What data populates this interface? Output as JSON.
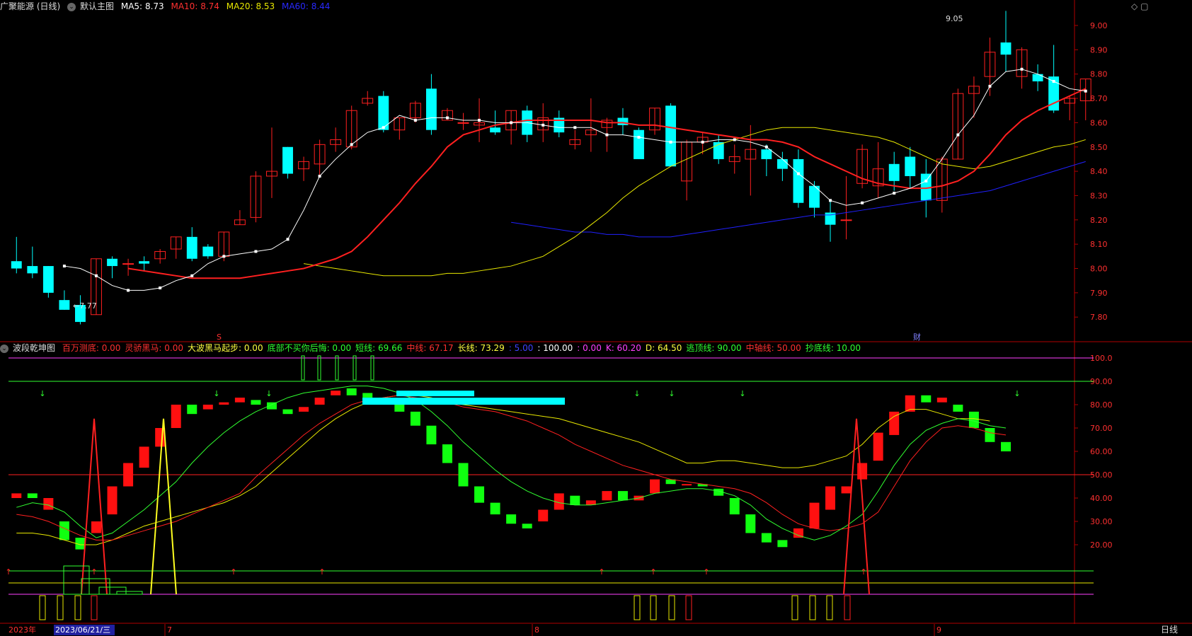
{
  "main_header": {
    "stock": "广聚能源 (日线)",
    "panel": "默认主图",
    "ma5_label": "MA5:",
    "ma5": "8.73",
    "ma10_label": "MA10:",
    "ma10": "8.74",
    "ma20_label": "MA20:",
    "ma20": "8.53",
    "ma60_label": "MA60:",
    "ma60": "8.44"
  },
  "sub_header": {
    "panel": "波段乾坤图",
    "items": [
      {
        "label": "百万测底:",
        "value": "0.00",
        "color": "#ff3030"
      },
      {
        "label": "灵骄黑马:",
        "value": "0.00",
        "color": "#ff3030"
      },
      {
        "label": "大波黑马起步:",
        "value": "0.00",
        "color": "#ffff40"
      },
      {
        "label": "底部不买你后悔:",
        "value": "0.00",
        "color": "#30ff30"
      },
      {
        "label": "短线:",
        "value": "69.66",
        "color": "#30ff30"
      },
      {
        "label": "中线:",
        "value": "67.17",
        "color": "#ff3030"
      },
      {
        "label": "长线:",
        "value": "73.29",
        "color": "#ffff40"
      },
      {
        "label": ":",
        "value": "5.00",
        "color": "#4040ff"
      },
      {
        "label": ":",
        "value": "100.00",
        "color": "#ffffff"
      },
      {
        "label": ":",
        "value": "0.00",
        "color": "#ff40ff"
      },
      {
        "label": "K:",
        "value": "60.20",
        "color": "#ff40ff"
      },
      {
        "label": "D:",
        "value": "64.50",
        "color": "#ffff40"
      },
      {
        "label": "逃顶线:",
        "value": "90.00",
        "color": "#30ff30"
      },
      {
        "label": "中轴线:",
        "value": "50.00",
        "color": "#ff3030"
      },
      {
        "label": "抄底线:",
        "value": "10.00",
        "color": "#30ff30"
      }
    ]
  },
  "price_axis": [
    "9.00",
    "8.90",
    "8.80",
    "8.70",
    "8.60",
    "8.50",
    "8.40",
    "8.30",
    "8.20",
    "8.10",
    "8.00",
    "7.90",
    "7.80"
  ],
  "osc_axis": [
    "100.0",
    "90.00",
    "80.00",
    "70.00",
    "60.00",
    "50.00",
    "40.00",
    "30.00",
    "20.00"
  ],
  "annotations": {
    "high": "9.05",
    "low": "7.77",
    "marker_s": "S",
    "marker_cai": "财"
  },
  "time_axis": {
    "year": "2023年",
    "cursor": "2023/06/21/三",
    "m7": "7",
    "m8": "8",
    "m9": "9"
  },
  "period": "日线",
  "colors": {
    "up": "#ff2020",
    "down": "#00ffff",
    "ma5": "#ffffff",
    "ma10": "#ff2020",
    "ma20": "#e8e800",
    "ma60": "#2020ff"
  },
  "chart_data": {
    "type": "candlestick",
    "candles": [
      [
        8.03,
        8.0,
        8.13,
        7.98
      ],
      [
        8.01,
        7.98,
        8.09,
        7.96
      ],
      [
        8.01,
        7.9,
        8.01,
        7.88
      ],
      [
        7.87,
        7.83,
        7.91,
        7.83
      ],
      [
        7.85,
        7.78,
        7.89,
        7.77
      ],
      [
        7.81,
        8.04,
        8.04,
        7.81
      ],
      [
        8.04,
        8.01,
        8.05,
        7.96
      ],
      [
        8.02,
        8.02,
        8.04,
        7.97
      ],
      [
        8.03,
        8.02,
        8.05,
        7.99
      ],
      [
        8.04,
        8.07,
        8.08,
        8.02
      ],
      [
        8.08,
        8.13,
        8.13,
        8.04
      ],
      [
        8.13,
        8.04,
        8.17,
        8.03
      ],
      [
        8.09,
        8.05,
        8.1,
        8.04
      ],
      [
        8.05,
        8.15,
        8.15,
        8.03
      ],
      [
        8.18,
        8.2,
        8.24,
        8.18
      ],
      [
        8.21,
        8.38,
        8.4,
        8.19
      ],
      [
        8.38,
        8.4,
        8.58,
        8.29
      ],
      [
        8.5,
        8.39,
        8.5,
        8.37
      ],
      [
        8.41,
        8.44,
        8.46,
        8.36
      ],
      [
        8.43,
        8.51,
        8.53,
        8.38
      ],
      [
        8.51,
        8.53,
        8.58,
        8.48
      ],
      [
        8.5,
        8.65,
        8.67,
        8.49
      ],
      [
        8.68,
        8.7,
        8.73,
        8.67
      ],
      [
        8.71,
        8.57,
        8.73,
        8.56
      ],
      [
        8.57,
        8.62,
        8.62,
        8.53
      ],
      [
        8.62,
        8.68,
        8.69,
        8.6
      ],
      [
        8.74,
        8.57,
        8.8,
        8.55
      ],
      [
        8.61,
        8.65,
        8.66,
        8.61
      ],
      [
        8.6,
        8.6,
        8.64,
        8.57
      ],
      [
        8.59,
        8.6,
        8.7,
        8.52
      ],
      [
        8.58,
        8.56,
        8.65,
        8.55
      ],
      [
        8.57,
        8.65,
        8.65,
        8.51
      ],
      [
        8.65,
        8.55,
        8.67,
        8.52
      ],
      [
        8.57,
        8.62,
        8.68,
        8.52
      ],
      [
        8.62,
        8.56,
        8.65,
        8.54
      ],
      [
        8.51,
        8.53,
        8.57,
        8.49
      ],
      [
        8.55,
        8.57,
        8.7,
        8.48
      ],
      [
        8.58,
        8.61,
        8.62,
        8.48
      ],
      [
        8.62,
        8.59,
        8.66,
        8.55
      ],
      [
        8.57,
        8.45,
        8.58,
        8.45
      ],
      [
        8.57,
        8.66,
        8.66,
        8.55
      ],
      [
        8.67,
        8.42,
        8.68,
        8.42
      ],
      [
        8.36,
        8.52,
        8.53,
        8.28
      ],
      [
        8.52,
        8.54,
        8.56,
        8.47
      ],
      [
        8.52,
        8.45,
        8.55,
        8.43
      ],
      [
        8.44,
        8.46,
        8.51,
        8.39
      ],
      [
        8.45,
        8.49,
        8.59,
        8.3
      ],
      [
        8.49,
        8.45,
        8.51,
        8.38
      ],
      [
        8.45,
        8.41,
        8.48,
        8.36
      ],
      [
        8.45,
        8.27,
        8.49,
        8.25
      ],
      [
        8.34,
        8.25,
        8.36,
        8.21
      ],
      [
        8.23,
        8.18,
        8.28,
        8.11
      ],
      [
        8.2,
        8.2,
        8.38,
        8.12
      ],
      [
        8.35,
        8.49,
        8.51,
        8.33
      ],
      [
        8.34,
        8.41,
        8.52,
        8.29
      ],
      [
        8.43,
        8.36,
        8.48,
        8.32
      ],
      [
        8.46,
        8.38,
        8.5,
        8.33
      ],
      [
        8.39,
        8.28,
        8.45,
        8.21
      ],
      [
        8.28,
        8.45,
        8.46,
        8.23
      ],
      [
        8.45,
        8.72,
        8.74,
        8.45
      ],
      [
        8.72,
        8.75,
        8.79,
        8.62
      ],
      [
        8.79,
        8.89,
        8.95,
        8.71
      ],
      [
        8.93,
        8.88,
        9.06,
        8.81
      ],
      [
        8.79,
        8.9,
        8.91,
        8.74
      ],
      [
        8.8,
        8.77,
        8.84,
        8.73
      ],
      [
        8.79,
        8.65,
        8.92,
        8.64
      ],
      [
        8.68,
        8.7,
        8.71,
        8.61
      ],
      [
        8.69,
        8.78,
        8.78,
        8.61
      ]
    ],
    "ma5": [
      8.01,
      8.0,
      7.97,
      7.93,
      7.91,
      7.91,
      7.92,
      7.95,
      7.97,
      8.02,
      8.05,
      8.06,
      8.07,
      8.08,
      8.12,
      8.24,
      8.38,
      8.45,
      8.51,
      8.56,
      8.58,
      8.63,
      8.61,
      8.62,
      8.62,
      8.61,
      8.61,
      8.6,
      8.6,
      8.6,
      8.59,
      8.58,
      8.58,
      8.58,
      8.55,
      8.55,
      8.54,
      8.53,
      8.52,
      8.52,
      8.52,
      8.53,
      8.53,
      8.52,
      8.5,
      8.45,
      8.39,
      8.34,
      8.28,
      8.26,
      8.27,
      8.29,
      8.31,
      8.33,
      8.36,
      8.45,
      8.55,
      8.63,
      8.75,
      8.81,
      8.82,
      8.8,
      8.77,
      8.74,
      8.73
    ],
    "ma10": [
      8.0,
      7.99,
      7.98,
      7.97,
      7.96,
      7.96,
      7.96,
      7.96,
      7.97,
      7.98,
      7.99,
      8.0,
      8.02,
      8.04,
      8.07,
      8.13,
      8.2,
      8.27,
      8.35,
      8.42,
      8.5,
      8.55,
      8.57,
      8.59,
      8.6,
      8.61,
      8.61,
      8.61,
      8.61,
      8.61,
      8.6,
      8.6,
      8.59,
      8.59,
      8.58,
      8.57,
      8.56,
      8.55,
      8.54,
      8.53,
      8.53,
      8.52,
      8.5,
      8.46,
      8.43,
      8.4,
      8.37,
      8.35,
      8.34,
      8.33,
      8.33,
      8.34,
      8.36,
      8.4,
      8.47,
      8.55,
      8.61,
      8.65,
      8.68,
      8.71,
      8.74
    ],
    "ma20": [
      8.02,
      8.01,
      8.0,
      7.99,
      7.98,
      7.97,
      7.97,
      7.97,
      7.97,
      7.98,
      7.98,
      7.99,
      8.0,
      8.01,
      8.03,
      8.05,
      8.09,
      8.13,
      8.18,
      8.23,
      8.29,
      8.34,
      8.38,
      8.42,
      8.45,
      8.48,
      8.51,
      8.53,
      8.55,
      8.57,
      8.58,
      8.58,
      8.58,
      8.57,
      8.56,
      8.55,
      8.54,
      8.52,
      8.49,
      8.46,
      8.43,
      8.42,
      8.41,
      8.42,
      8.44,
      8.46,
      8.48,
      8.5,
      8.51,
      8.53
    ],
    "ma60": [
      8.19,
      8.18,
      8.17,
      8.16,
      8.15,
      8.15,
      8.14,
      8.14,
      8.13,
      8.13,
      8.13,
      8.14,
      8.15,
      8.16,
      8.17,
      8.18,
      8.19,
      8.2,
      8.21,
      8.22,
      8.22,
      8.23,
      8.24,
      8.25,
      8.26,
      8.27,
      8.28,
      8.29,
      8.3,
      8.31,
      8.32,
      8.34,
      8.36,
      8.38,
      8.4,
      8.42,
      8.44
    ],
    "osc_bars": [
      [
        40,
        42
      ],
      [
        42,
        40
      ],
      [
        35,
        40
      ],
      [
        30,
        22
      ],
      [
        23,
        18
      ],
      [
        25,
        30
      ],
      [
        33,
        45
      ],
      [
        45,
        55
      ],
      [
        53,
        62
      ],
      [
        62,
        70
      ],
      [
        70,
        80
      ],
      [
        80,
        76
      ],
      [
        78,
        80
      ],
      [
        80,
        81
      ],
      [
        81,
        83
      ],
      [
        82,
        80
      ],
      [
        81,
        78
      ],
      [
        78,
        76
      ],
      [
        77,
        79
      ],
      [
        80,
        83
      ],
      [
        84,
        86
      ],
      [
        87,
        84
      ],
      [
        85,
        83
      ],
      [
        83,
        82
      ],
      [
        82,
        77
      ],
      [
        77,
        71
      ],
      [
        71,
        63
      ],
      [
        63,
        55
      ],
      [
        55,
        45
      ],
      [
        45,
        38
      ],
      [
        38,
        33
      ],
      [
        33,
        29
      ],
      [
        29,
        27
      ],
      [
        30,
        35
      ],
      [
        35,
        42
      ],
      [
        41,
        37
      ],
      [
        37,
        39
      ],
      [
        39,
        43
      ],
      [
        43,
        39
      ],
      [
        39,
        41
      ],
      [
        42,
        48
      ],
      [
        48,
        46
      ],
      [
        46,
        46
      ],
      [
        46,
        45
      ],
      [
        44,
        41
      ],
      [
        40,
        33
      ],
      [
        33,
        25
      ],
      [
        25,
        21
      ],
      [
        22,
        19
      ],
      [
        23,
        27
      ],
      [
        27,
        38
      ],
      [
        35,
        45
      ],
      [
        42,
        45
      ],
      [
        48,
        55
      ],
      [
        56,
        68
      ],
      [
        67,
        77
      ],
      [
        77,
        84
      ],
      [
        84,
        81
      ],
      [
        81,
        83
      ],
      [
        80,
        77
      ],
      [
        77,
        70
      ],
      [
        70,
        64
      ],
      [
        64,
        60
      ]
    ],
    "short_line": [
      36,
      38,
      37,
      34,
      28,
      23,
      25,
      30,
      35,
      41,
      47,
      55,
      62,
      68,
      73,
      77,
      80,
      83,
      85,
      86,
      87,
      88,
      88,
      87,
      85,
      82,
      77,
      71,
      64,
      58,
      52,
      47,
      43,
      40,
      38,
      37,
      37,
      38,
      39,
      40,
      42,
      43,
      44,
      44,
      43,
      41,
      37,
      31,
      27,
      24,
      22,
      24,
      28,
      33,
      43,
      54,
      63,
      69,
      72,
      74,
      73,
      71,
      70
    ],
    "mid_line": [
      33,
      32,
      30,
      27,
      24,
      22,
      22,
      24,
      26,
      28,
      30,
      33,
      36,
      39,
      42,
      49,
      55,
      61,
      67,
      72,
      76,
      80,
      82,
      83,
      84,
      83,
      82,
      81,
      79,
      78,
      77,
      75,
      73,
      70,
      67,
      63,
      60,
      57,
      54,
      52,
      50,
      48,
      47,
      46,
      45,
      44,
      42,
      38,
      33,
      29,
      27,
      26,
      27,
      29,
      34,
      45,
      56,
      64,
      70,
      71,
      70,
      68,
      67
    ],
    "long_line": [
      25,
      25,
      24,
      22,
      20,
      20,
      22,
      25,
      28,
      30,
      32,
      34,
      36,
      38,
      41,
      45,
      51,
      57,
      63,
      69,
      74,
      78,
      81,
      83,
      84,
      84,
      83,
      81,
      80,
      79,
      78,
      77,
      76,
      75,
      74,
      72,
      70,
      68,
      66,
      64,
      61,
      58,
      55,
      55,
      56,
      56,
      55,
      54,
      53,
      53,
      54,
      56,
      58,
      63,
      70,
      75,
      78,
      78,
      76,
      74,
      74,
      73
    ]
  }
}
